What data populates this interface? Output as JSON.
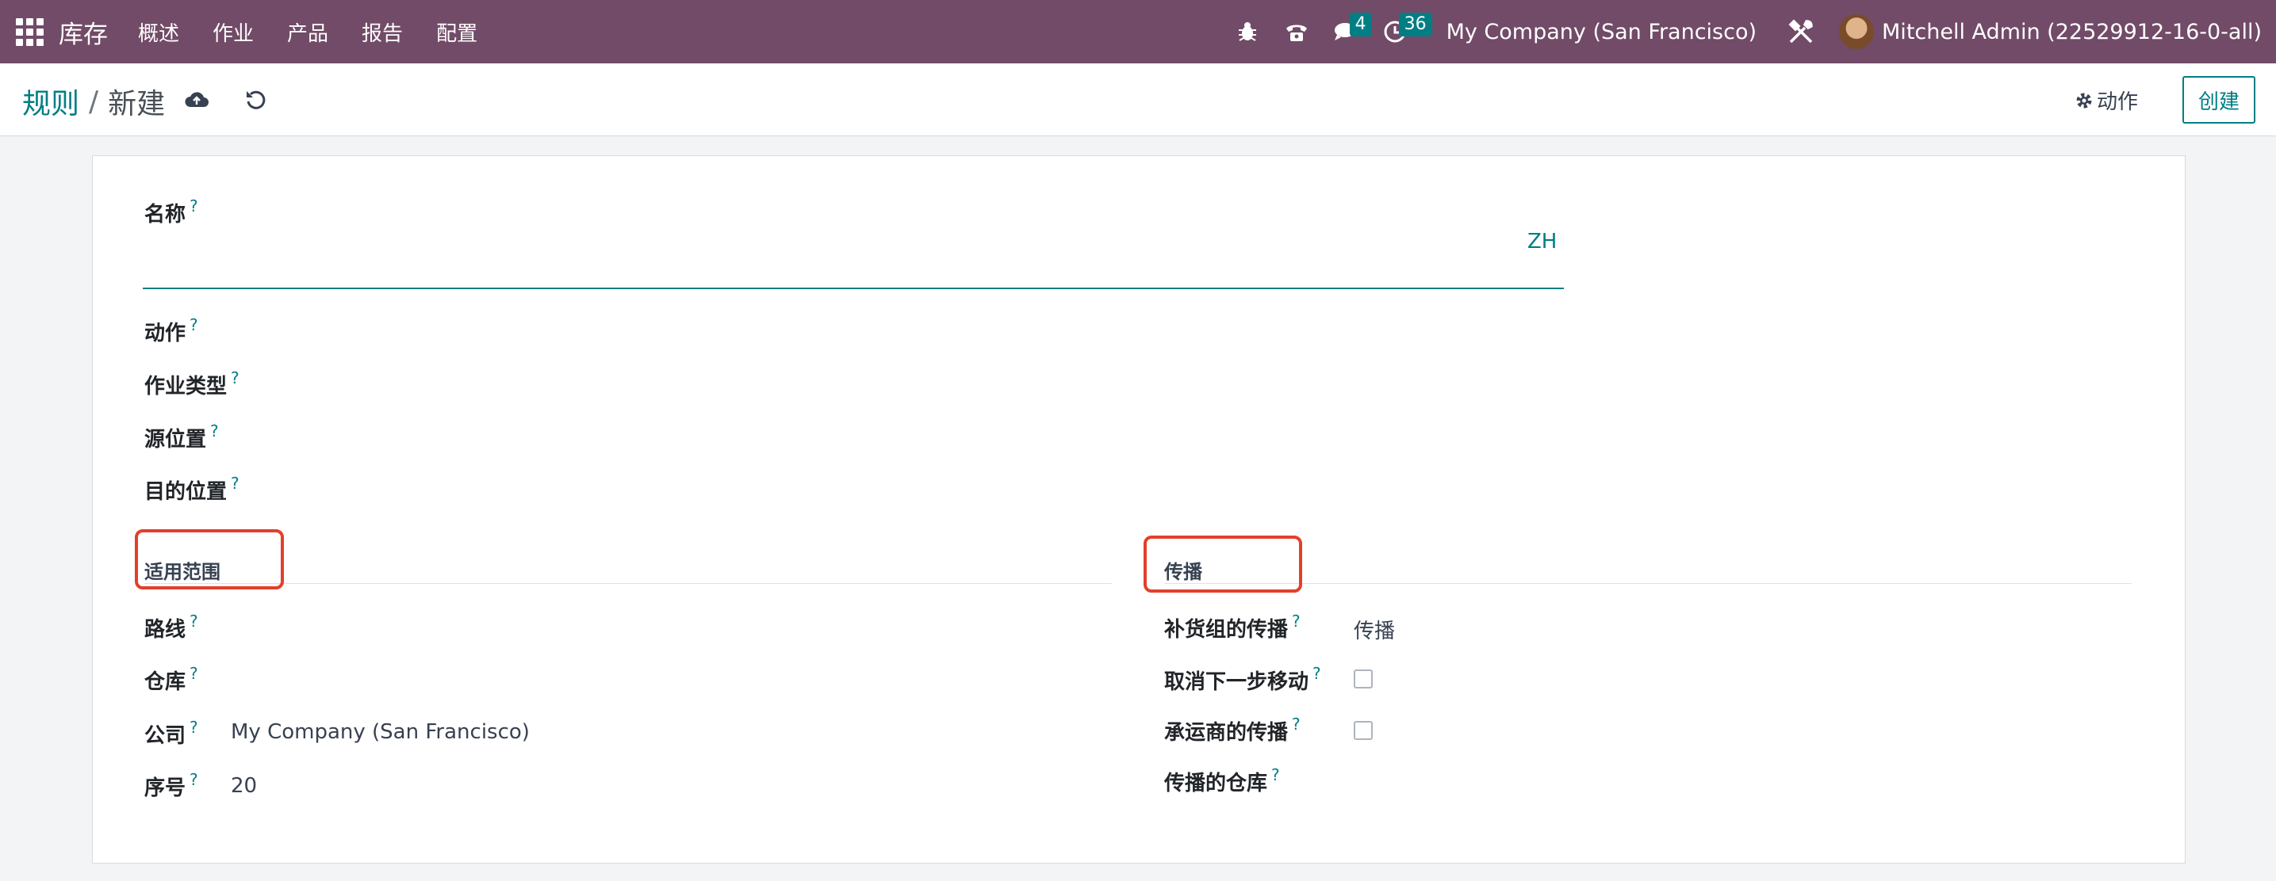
{
  "navbar": {
    "app_name": "库存",
    "menus": [
      "概述",
      "作业",
      "产品",
      "报告",
      "配置"
    ],
    "messages_count": "4",
    "activities_count": "36",
    "company": "My Company (San Francisco)",
    "user": "Mitchell Admin (22529912-16-0-all)",
    "brand_color": "#714b67",
    "badge_color": "#017e84"
  },
  "control_panel": {
    "breadcrumb_parent": "规则",
    "breadcrumb_separator": "/",
    "breadcrumb_current": "新建",
    "action_label": "动作",
    "create_label": "创建"
  },
  "form": {
    "name_label": "名称",
    "name_value": "",
    "language_code": "ZH",
    "action_label": "动作",
    "operation_type_label": "作业类型",
    "source_location_label": "源位置",
    "destination_location_label": "目的位置",
    "applicability": {
      "title": "适用范围",
      "route_label": "路线",
      "warehouse_label": "仓库",
      "company_label": "公司",
      "company_value": "My Company (San Francisco)",
      "sequence_label": "序号",
      "sequence_value": "20"
    },
    "propagation": {
      "title": "传播",
      "group_propagation_label": "补货组的传播",
      "group_propagation_value": "传播",
      "cancel_next_move_label": "取消下一步移动",
      "cancel_next_move_checked": false,
      "carrier_propagation_label": "承运商的传播",
      "carrier_propagation_checked": false,
      "warehouse_to_propagate_label": "传播的仓库"
    },
    "help_marker": "?",
    "highlight_color": "#e2402a"
  }
}
